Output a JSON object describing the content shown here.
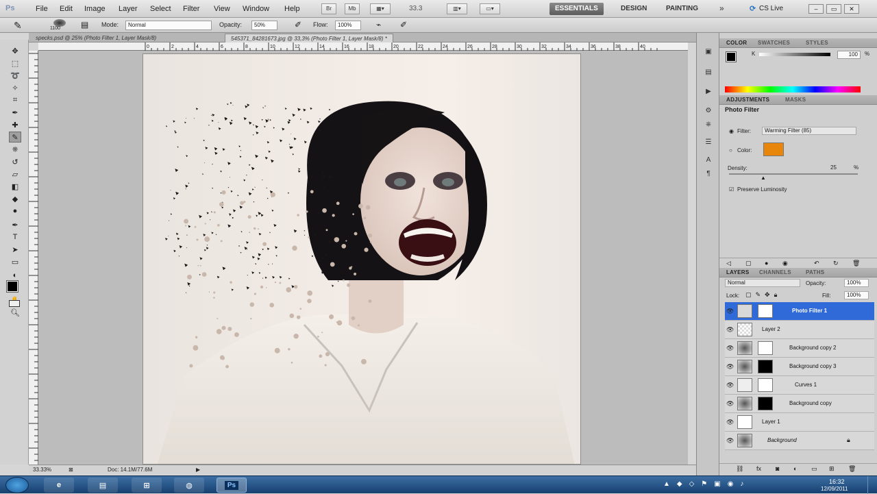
{
  "app": {
    "logo": "Ps"
  },
  "menubar": {
    "items": [
      "File",
      "Edit",
      "Image",
      "Layer",
      "Select",
      "Filter",
      "View",
      "Window",
      "Help"
    ],
    "zoom": "33.3",
    "workspaces": [
      "ESSENTIALS",
      "DESIGN",
      "PAINTING"
    ],
    "more": "»",
    "cslive": "CS Live"
  },
  "options_bar": {
    "brush_size": "1100",
    "mode_label": "Mode:",
    "mode_value": "Normal",
    "opacity_label": "Opacity:",
    "opacity_value": "50%",
    "flow_label": "Flow:",
    "flow_value": "100%"
  },
  "document_tabs": [
    {
      "label": "specks.psd @ 25% (Photo Filter 1, Layer Mask/8)",
      "active": false
    },
    {
      "label": "545371_84281673.jpg @ 33,3% (Photo Filter 1, Layer Mask/8) *",
      "active": true
    }
  ],
  "ruler": {
    "marks": [
      "0",
      "2",
      "4",
      "6",
      "8",
      "10",
      "12",
      "14",
      "16",
      "18",
      "20",
      "22",
      "24",
      "26",
      "28",
      "30",
      "32",
      "34",
      "36",
      "38",
      "40"
    ]
  },
  "status": {
    "zoom": "33.33%",
    "doc": "Doc: 14.1M/77.6M"
  },
  "color_panel": {
    "tabs": [
      "COLOR",
      "SWATCHES",
      "STYLES"
    ],
    "k_label": "K",
    "k_value": "100",
    "pct": "%"
  },
  "adjustments_panel": {
    "tabs": [
      "ADJUSTMENTS",
      "MASKS"
    ],
    "title": "Photo Filter",
    "filter_label": "Filter:",
    "filter_value": "Warming Filter (85)",
    "color_label": "Color:",
    "swatch_color": "#e8860c",
    "density_label": "Density:",
    "density_value": "25",
    "density_pct": "%",
    "preserve_label": "Preserve Luminosity"
  },
  "layers_panel": {
    "tabs": [
      "LAYERS",
      "CHANNELS",
      "PATHS"
    ],
    "blend_mode": "Normal",
    "opacity_label": "Opacity:",
    "opacity_value": "100%",
    "lock_label": "Lock:",
    "fill_label": "Fill:",
    "fill_value": "100%",
    "layers": [
      {
        "name": "Photo Filter 1",
        "selected": true
      },
      {
        "name": "Layer 2",
        "selected": false
      },
      {
        "name": "Background copy 2",
        "selected": false
      },
      {
        "name": "Background copy 3",
        "selected": false
      },
      {
        "name": "Curves 1",
        "selected": false
      },
      {
        "name": "Background copy",
        "selected": false
      },
      {
        "name": "Layer 1",
        "selected": false
      },
      {
        "name": "Background",
        "selected": false
      }
    ]
  },
  "taskbar": {
    "time": "16:32",
    "date": "12/09/2011",
    "ps_label": "Ps"
  },
  "colors": {
    "selection": "#2f6ad8",
    "accent": "#e8860c"
  }
}
